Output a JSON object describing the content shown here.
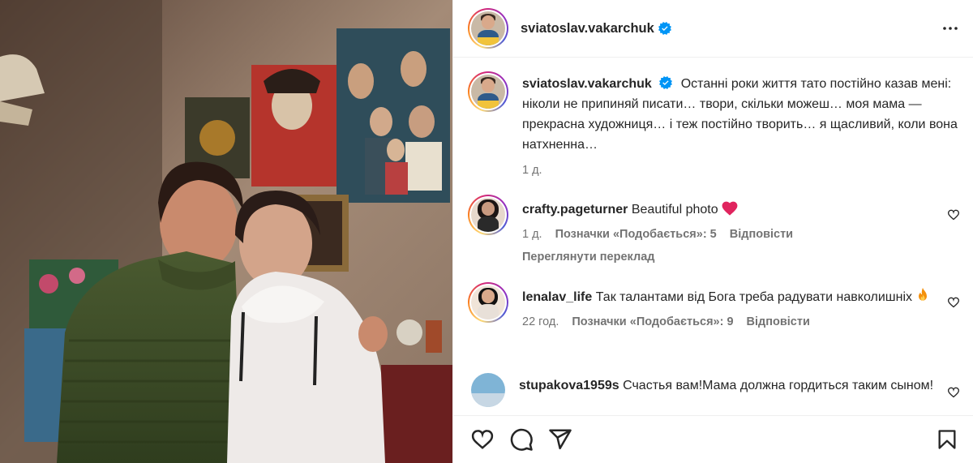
{
  "header": {
    "username": "sviatoslav.vakarchuk",
    "verified": true,
    "icons": {
      "verified": "verified-badge-icon",
      "more": "more-options-icon"
    }
  },
  "caption": {
    "username": "sviatoslav.vakarchuk",
    "text": "Останні роки життя тато постійно казав мені: ніколи не припиняй писати… твори, скільки можеш… моя мама — прекрасна художниця… і теж постійно творить… я щасливий, коли вона натхненна…",
    "time": "1 д."
  },
  "comments": [
    {
      "username": "crafty.pageturner",
      "text": "Beautiful photo",
      "emoji": "red-heart-emoji",
      "time": "1 д.",
      "likes": "Позначки «Подобається»: 5",
      "reply": "Відповісти",
      "extra": "Переглянути переклад"
    },
    {
      "username": "lenalav_life",
      "text": "Так талантами від Бога треба радувати навколишніх",
      "emoji": "fire-emoji",
      "time": "22 год.",
      "likes": "Позначки «Подобається»: 9",
      "reply": "Відповісти"
    },
    {
      "username": "stupakova1959s",
      "text": "Счастья вам!Мама должна гордиться таким сыном!"
    }
  ],
  "actions": {
    "like": "heart-icon",
    "comment": "comment-icon",
    "share": "share-icon",
    "save": "bookmark-icon"
  },
  "colors": {
    "text": "#262626",
    "secondary": "#737373",
    "verified": "#0095f6",
    "divider": "#efefef"
  }
}
